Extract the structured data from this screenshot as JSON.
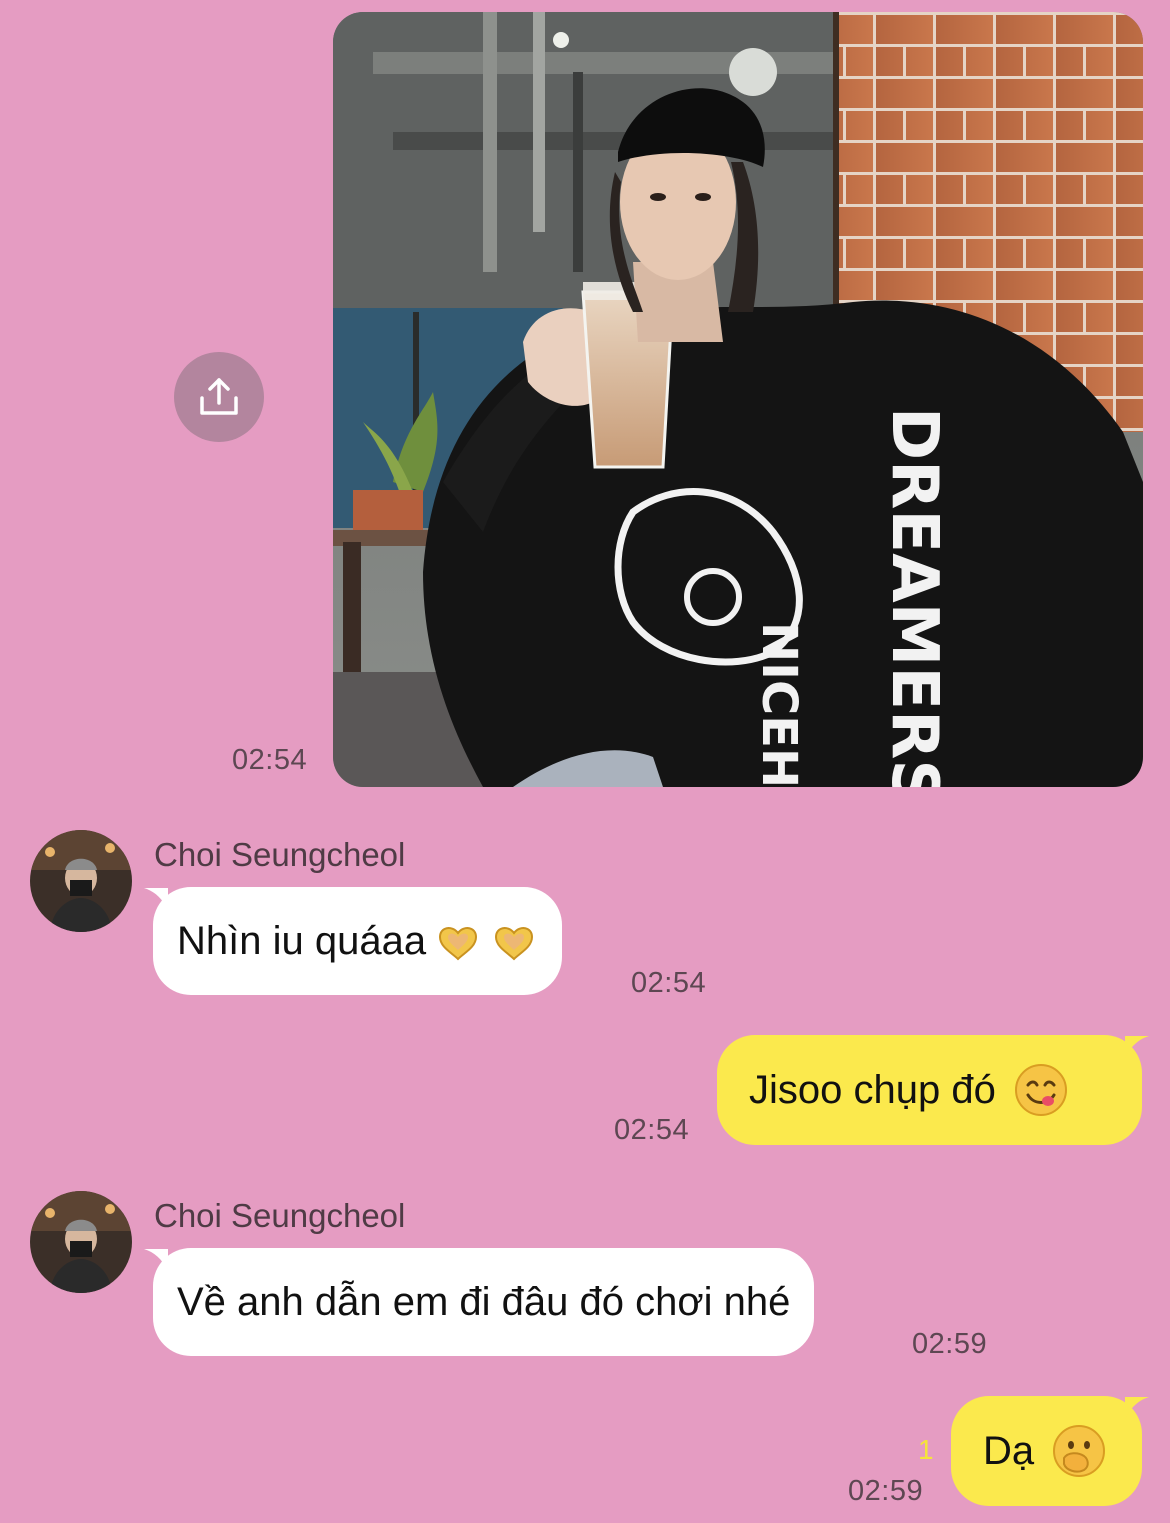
{
  "messages": [
    {
      "type": "photo",
      "direction": "out",
      "time": "02:54",
      "shirt_text_top": "DREAMERS",
      "shirt_text_bottom": "NICEHOSTCLUB"
    },
    {
      "type": "text",
      "direction": "in",
      "sender": "Choi Seungcheol",
      "text": "Nhìn iu quáaa",
      "emoji": "heart-hands x2",
      "time": "02:54"
    },
    {
      "type": "text",
      "direction": "out",
      "text": "Jisoo chụp đó",
      "emoji": "yum-face",
      "time": "02:54"
    },
    {
      "type": "text",
      "direction": "in",
      "sender": "Choi Seungcheol",
      "text": "Về anh dẫn em đi đâu đó chơi nhé",
      "time": "02:59"
    },
    {
      "type": "text",
      "direction": "out",
      "text": "Dạ",
      "emoji": "hand-over-mouth-face",
      "time": "02:59",
      "unread_count": "1"
    }
  ],
  "colors": {
    "background": "#e59cc2",
    "incoming_bubble": "#ffffff",
    "outgoing_bubble": "#fbe94d",
    "share_button": "#b3859e"
  }
}
